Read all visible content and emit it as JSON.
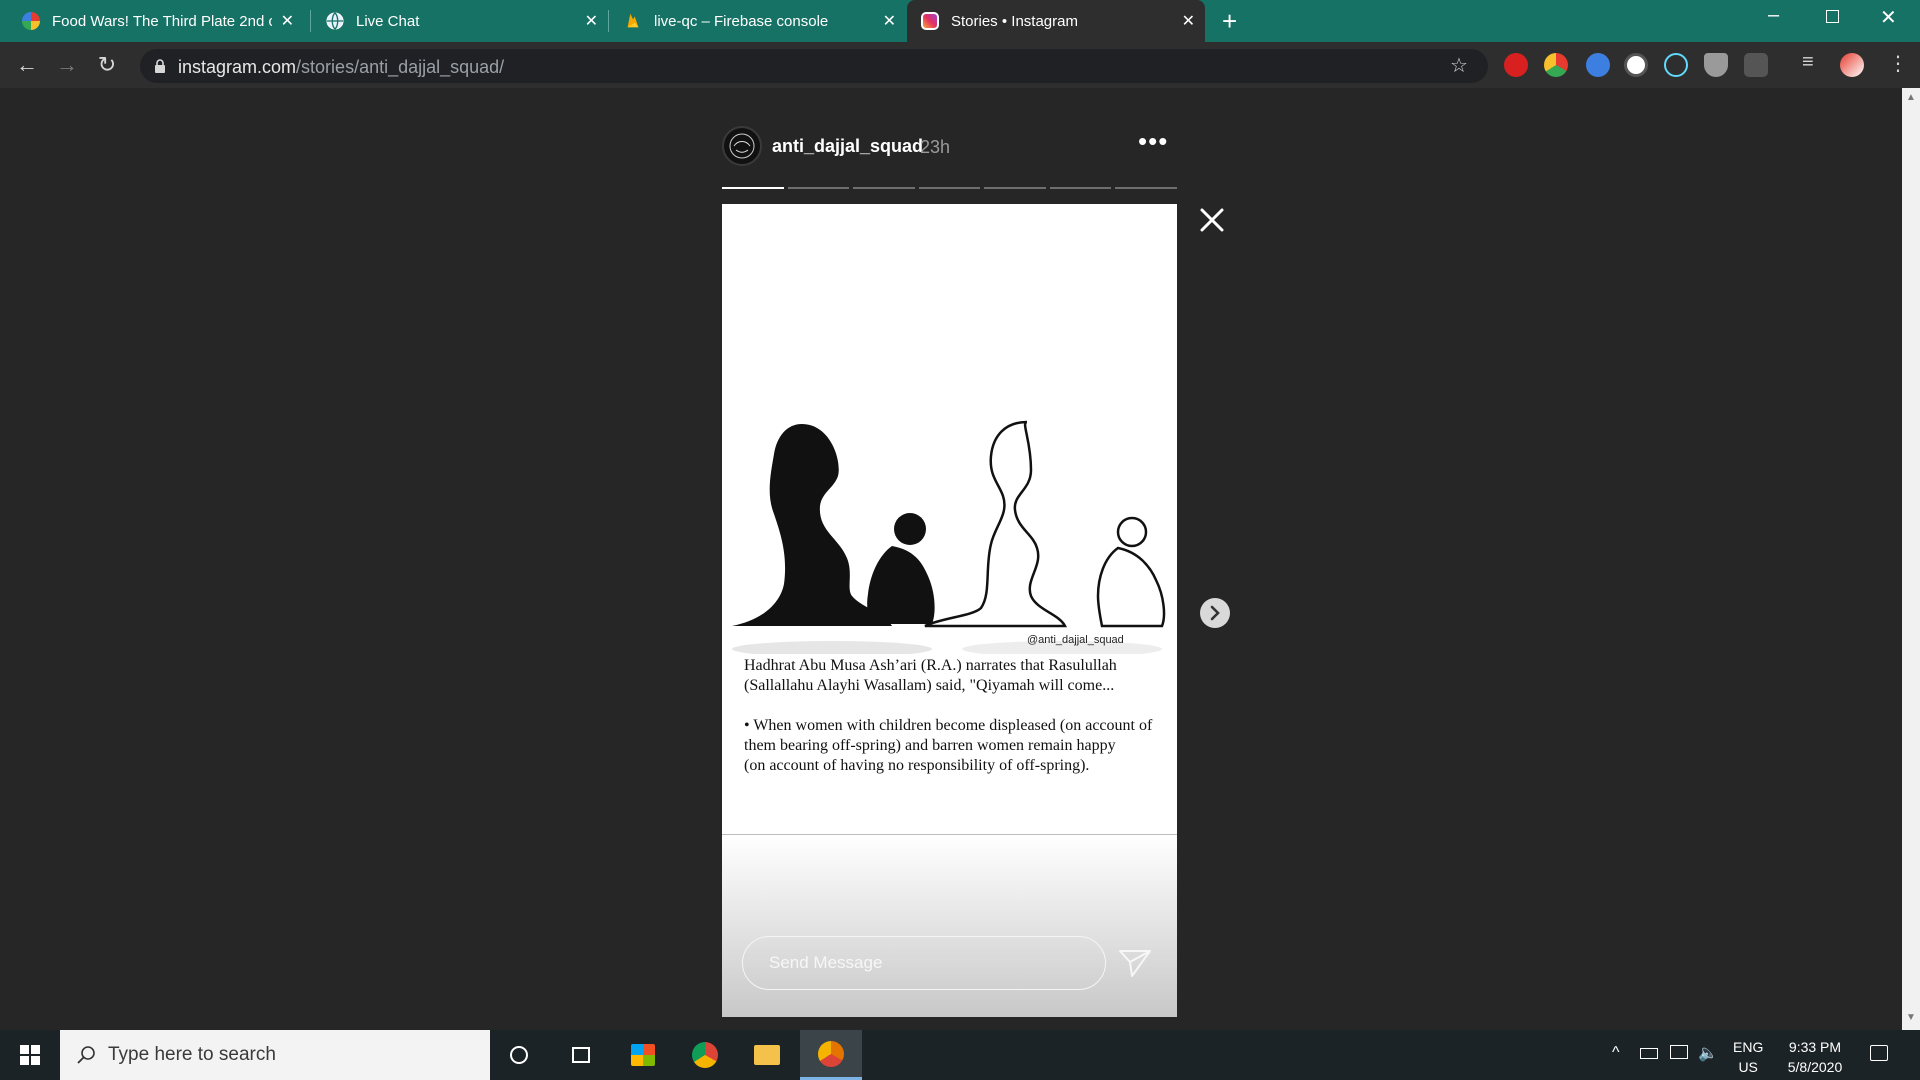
{
  "browser": {
    "tabs": [
      {
        "title": "Food Wars! The Third Plate 2nd c",
        "favicon": "anime-site-icon",
        "active": false
      },
      {
        "title": "Live Chat",
        "favicon": "globe-icon",
        "active": false
      },
      {
        "title": "live-qc – Firebase console",
        "favicon": "firebase-icon",
        "active": false
      },
      {
        "title": "Stories • Instagram",
        "favicon": "instagram-icon",
        "active": true
      }
    ],
    "url_host": "instagram.com",
    "url_path": "/stories/anti_dajjal_squad/"
  },
  "story": {
    "username": "anti_dajjal_squad",
    "time_ago": "23h",
    "segments_total": 7,
    "segment_current": 1,
    "watermark": "@anti_dajjal_squad",
    "caption_paragraphs": [
      "Hadhrat Abu Musa Ash’ari (R.A.) narrates that Rasulullah (Sallallahu Alayhi Wasallam) said, \"Qiyamah will come...",
      "• When women with children become displeased (on account of them bearing off-spring) and barren women remain happy\n(on account of having no responsibility of off-spring)."
    ],
    "message_placeholder": "Send Message"
  },
  "taskbar": {
    "search_placeholder": "Type here to search",
    "lang_primary": "ENG",
    "lang_secondary": "US",
    "time": "9:33 PM",
    "date": "5/8/2020"
  },
  "colors": {
    "tabbar": "#157265",
    "toolbar": "#2e2e2e",
    "page_bg": "#262626",
    "taskbar": "#1c2326"
  }
}
